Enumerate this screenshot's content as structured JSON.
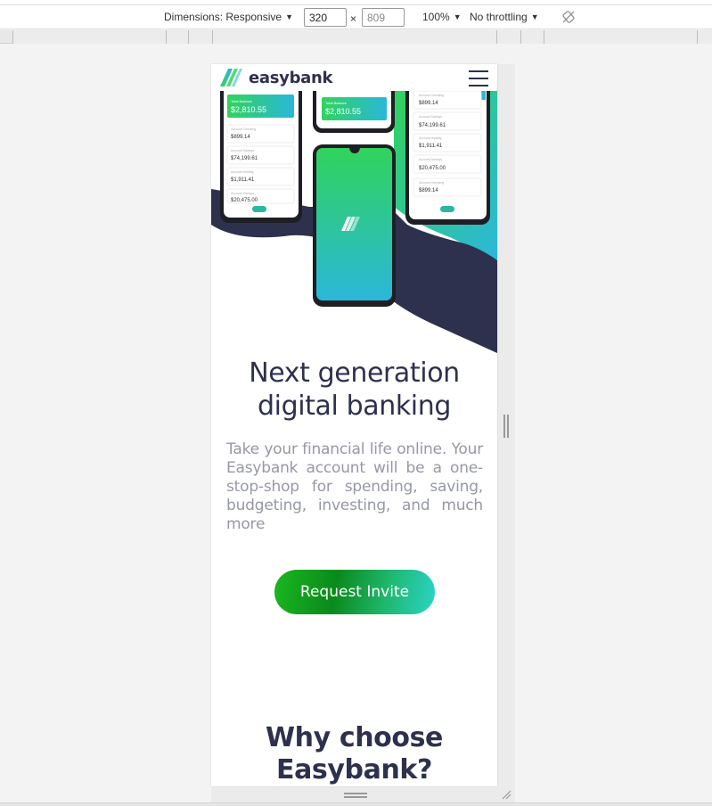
{
  "devtools": {
    "dimensions_label": "Dimensions: Responsive",
    "width_value": "320",
    "height_value": "809",
    "times": "×",
    "zoom_label": "100%",
    "throttle_label": "No throttling",
    "rotate_icon": "rotate-disabled-icon"
  },
  "site": {
    "logo_text": "easybank",
    "menu_icon": "hamburger-menu-icon",
    "hero": {
      "phones": [
        {
          "balance_label": "Total Balance",
          "balance": "$2,810.55",
          "rows": [
            {
              "label": "Account Checking",
              "amount": "$899.14"
            },
            {
              "label": "Account Savings",
              "amount": "$74,199.61"
            },
            {
              "label": "Account Holding",
              "amount": "$1,911.41"
            },
            {
              "label": "Account Savings",
              "amount": "$20,475.00"
            }
          ]
        },
        {
          "balance_label": "Total Balance",
          "balance": "$2,810.55"
        },
        {
          "rows": [
            {
              "label": "Account Checking",
              "amount": "$899.14"
            },
            {
              "label": "Account Savings",
              "amount": "$74,199.61"
            },
            {
              "label": "Account Holding",
              "amount": "$1,911.41"
            },
            {
              "label": "Account Savings",
              "amount": "$20,475.00"
            },
            {
              "label": "Account Checking",
              "amount": "$899.14"
            }
          ]
        }
      ]
    },
    "headline": "Next generation digital banking",
    "lead": "Take your financial life online. Your Easybank account will be a one-stop-shop for spending, saving, budgeting, investing, and much more",
    "cta_label": "Request Invite",
    "section_title": "Why choose Easybank?"
  },
  "colors": {
    "navy": "#2d314d",
    "green": "#31d35c",
    "cyan": "#2bb7da",
    "gray_text": "#9698a6"
  }
}
